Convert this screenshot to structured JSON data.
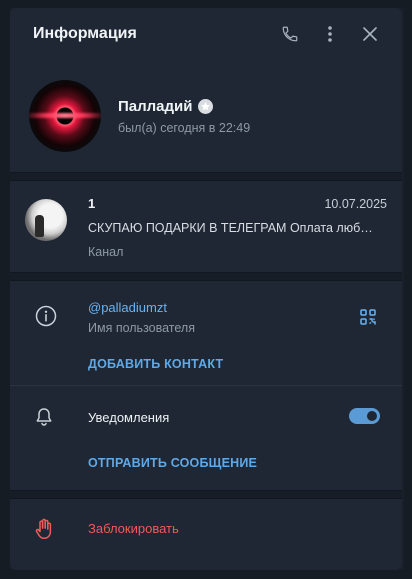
{
  "panel": {
    "title": "Информация"
  },
  "profile": {
    "name": "Палладий",
    "status": "был(а) сегодня в 22:49"
  },
  "channel": {
    "name": "1",
    "date": "10.07.2025",
    "message": "СКУПАЮ ПОДАРКИ В ТЕЛЕГРАМ Оплата люб…",
    "type": "Канал"
  },
  "info": {
    "username": "@palladiumzt",
    "username_label": "Имя пользователя",
    "add_contact": "ДОБАВИТЬ КОНТАКТ"
  },
  "notifications": {
    "label": "Уведомления",
    "enabled": true,
    "send_message": "ОТПРАВИТЬ СООБЩЕНИЕ"
  },
  "block": {
    "label": "Заблокировать"
  },
  "colors": {
    "accent": "#6ab3f3",
    "danger": "#ef5b5b",
    "panel_bg": "#1e2733"
  }
}
